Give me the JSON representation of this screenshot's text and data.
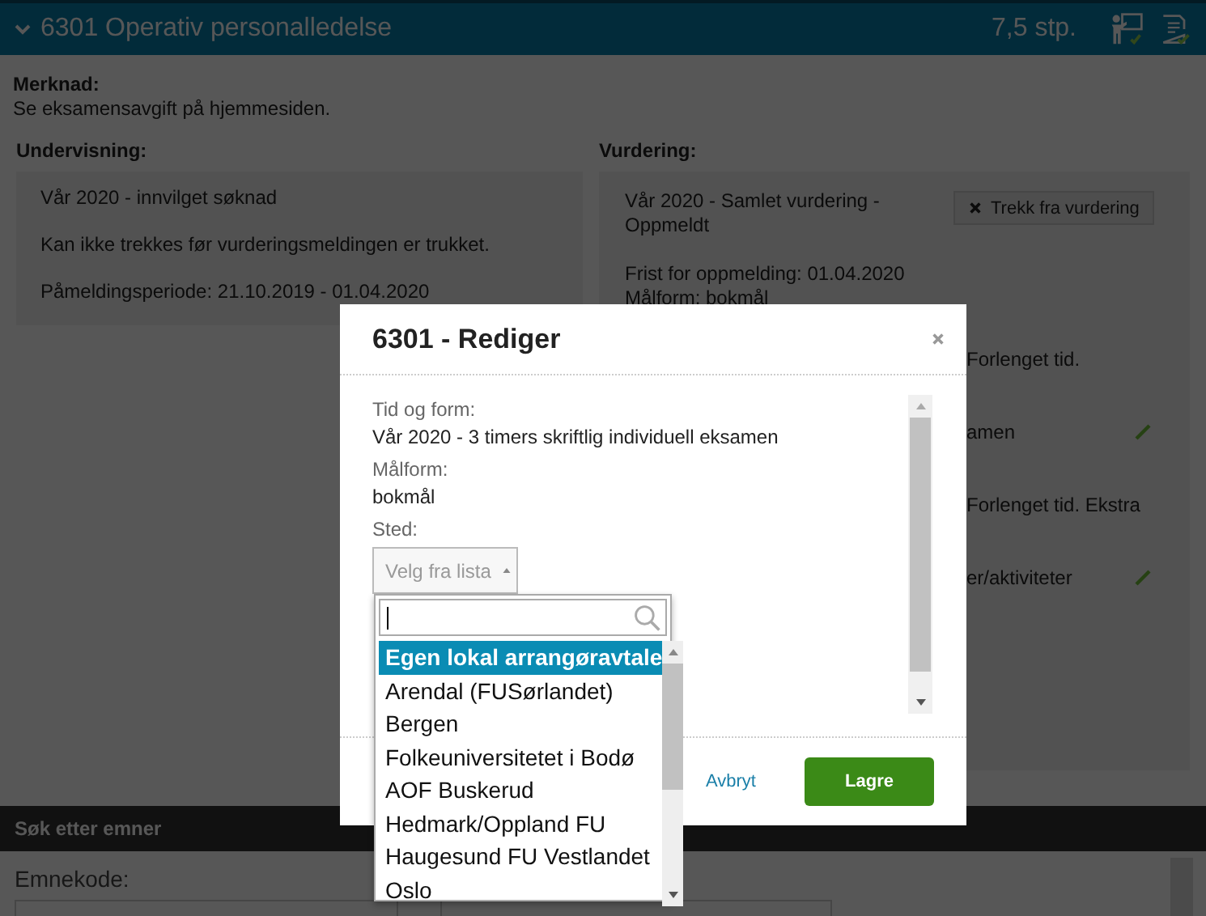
{
  "course": {
    "title": "6301 Operativ personalledelse",
    "credits": "7,5 stp.",
    "expanded": true
  },
  "note": {
    "label": "Merknad:",
    "text": "Se eksamensavgift på hjemmesiden."
  },
  "teaching": {
    "heading": "Undervisning:",
    "lines": [
      "Vår 2020 - innvilget søknad",
      "Kan ikke trekkes før vurderingsmeldingen er trukket.",
      "Påmeldingsperiode: 21.10.2019 - 01.04.2020"
    ]
  },
  "assessment": {
    "heading": "Vurdering:",
    "title": "Vår 2020 - Samlet vurdering - Oppmeldt",
    "lines": [
      "Frist for oppmelding: 01.04.2020",
      "Målform: bokmål"
    ],
    "withdraw_button": "Trekk fra vurdering",
    "details": [
      {
        "text": "Forlenget tid.",
        "editable": false
      },
      {
        "text": "amen",
        "editable": true
      },
      {
        "text": "Forlenget tid. Ekstra",
        "editable": false
      },
      {
        "text": "er/aktiviteter",
        "editable": true
      }
    ]
  },
  "search": {
    "heading": "Søk etter emner",
    "field_label": "Emnekode:"
  },
  "dialog": {
    "title": "6301 - Rediger",
    "fields": [
      {
        "label": "Tid og form:",
        "value": "Vår 2020 - 3 timers skriftlig individuell eksamen"
      },
      {
        "label": "Målform:",
        "value": "bokmål"
      }
    ],
    "place": {
      "label": "Sted:",
      "placeholder": "Velg fra lista",
      "open": true,
      "options": [
        {
          "label": "Egen lokal arrangøravtale",
          "selected": true
        },
        {
          "label": "Arendal (FUSørlandet)",
          "selected": false
        },
        {
          "label": "Bergen",
          "selected": false
        },
        {
          "label": "Folkeuniversitetet i Bodø",
          "selected": false
        },
        {
          "label": "AOF Buskerud",
          "selected": false
        },
        {
          "label": "Hedmark/Oppland FU",
          "selected": false
        },
        {
          "label": "Haugesund FU Vestlandet",
          "selected": false
        },
        {
          "label": "Oslo",
          "selected": false
        }
      ]
    },
    "cancel": "Avbryt",
    "save": "Lagre"
  }
}
